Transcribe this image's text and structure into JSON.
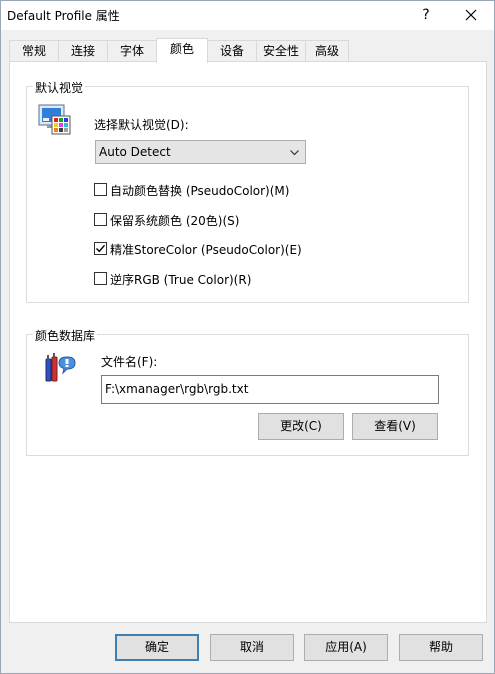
{
  "window": {
    "title": "Default Profile 属性",
    "help_glyph": "?"
  },
  "tabs": [
    {
      "label": "常规"
    },
    {
      "label": "连接"
    },
    {
      "label": "字体"
    },
    {
      "label": "颜色",
      "active": true
    },
    {
      "label": "设备"
    },
    {
      "label": "安全性"
    },
    {
      "label": "高级"
    }
  ],
  "visual_group": {
    "title": "默认视觉",
    "select_label": "选择默认视觉(D):",
    "select_value": "Auto Detect",
    "options": [
      {
        "label": "自动颜色替换 (PseudoColor)(M)",
        "checked": false
      },
      {
        "label": "保留系统颜色 (20色)(S)",
        "checked": false
      },
      {
        "label": "精准StoreColor (PseudoColor)(E)",
        "checked": true
      },
      {
        "label": "逆序RGB (True Color)(R)",
        "checked": false
      }
    ]
  },
  "db_group": {
    "title": "颜色数据库",
    "file_label": "文件名(F):",
    "file_value": "F:\\xmanager\\rgb\\rgb.txt",
    "change_button": "更改(C)",
    "view_button": "查看(V)"
  },
  "footer": {
    "ok": "确定",
    "cancel": "取消",
    "apply": "应用(A)",
    "help": "帮助"
  },
  "icons": {
    "visual_icon": "palette-monitor-icon",
    "db_icon": "color-database-icon",
    "close_icon": "close-icon",
    "dropdown_icon": "chevron-down-icon"
  },
  "colors": {
    "accent_border": "#3c7fb1",
    "panel_bg": "#ffffff",
    "dialog_bg": "#f0f0f0"
  }
}
